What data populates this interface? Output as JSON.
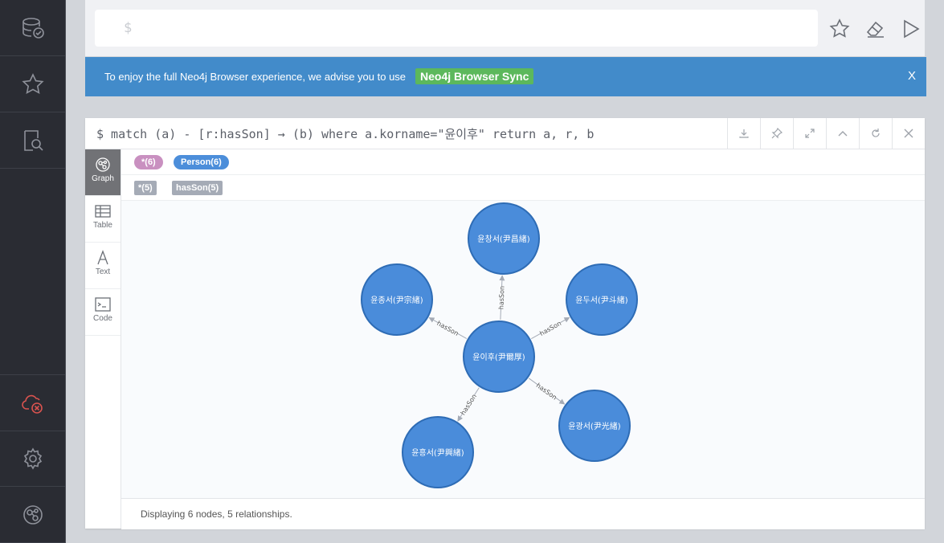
{
  "editor": {
    "prompt": "$"
  },
  "banner": {
    "text": "To enjoy the full Neo4j Browser experience, we advise you to use",
    "button": "Neo4j Browser Sync",
    "close": "X"
  },
  "frame": {
    "command": "$ match (a) - [r:hasSon] → (b) where a.korname=\"윤이후\" return a, r, b",
    "tabs": [
      {
        "label": "Graph",
        "icon": "graph-icon"
      },
      {
        "label": "Table",
        "icon": "table-icon"
      },
      {
        "label": "Text",
        "icon": "text-icon"
      },
      {
        "label": "Code",
        "icon": "code-icon"
      }
    ],
    "labels": [
      {
        "text": "*(6)",
        "color": "#c990c0"
      },
      {
        "text": "Person(6)",
        "color": "#4c8eda"
      }
    ],
    "reltypes": [
      {
        "text": "*(5)"
      },
      {
        "text": "hasSon(5)"
      }
    ],
    "status": "Displaying 6 nodes, 5 relationships."
  },
  "graph": {
    "node_color": "#4a8cda",
    "node_border": "#2e6cb5",
    "center": "윤이후(尹爾厚)",
    "children": [
      "윤창서(尹昌緖)",
      "윤두서(尹斗緖)",
      "윤광서(尹光緖)",
      "윤흥서(尹興緖)",
      "윤종서(尹宗緖)"
    ],
    "relationship": "hasSon"
  },
  "sidebar": {
    "icons": [
      "database-icon",
      "star-icon",
      "search-docs-icon",
      "disconnected-icon",
      "gear-icon",
      "neo4j-logo-icon"
    ]
  }
}
